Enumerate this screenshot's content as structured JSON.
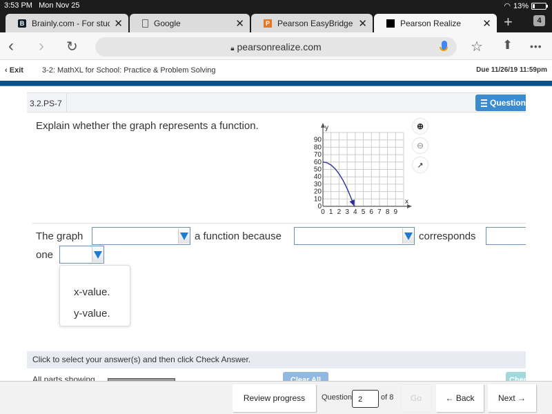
{
  "status_bar": {
    "time": "3:53 PM",
    "date": "Mon Nov 25",
    "battery": "13%"
  },
  "browser": {
    "tabs": [
      {
        "label": "Brainly.com - For students",
        "favicon": "B",
        "favicon_color": "#0e1e2e",
        "active": false
      },
      {
        "label": "Google",
        "favicon": "page-icon",
        "active": false
      },
      {
        "label": "Pearson EasyBridge",
        "favicon": "P",
        "favicon_color": "#e87722",
        "active": false
      },
      {
        "label": "Pearson Realize",
        "favicon": "realize-logo",
        "favicon_color": "#000000",
        "active": true
      }
    ],
    "tab_count": "4",
    "url": "pearsonrealize.com"
  },
  "app_header": {
    "exit_label": "Exit",
    "assignment_title": "3-2: MathXL for School: Practice & Problem Solving",
    "due": "Due 11/26/19 11:59pm"
  },
  "question": {
    "id": "3.2.PS-7",
    "question_button_label": "Question",
    "prompt": "Explain whether the graph represents a function.",
    "sentence": {
      "part1": "The graph",
      "part2": "a function because",
      "part3": "corresponds",
      "part4": "one"
    },
    "dropdowns": {
      "is_is_not": {
        "value": ""
      },
      "because": {
        "value": ""
      },
      "corresponds": {
        "value": ""
      },
      "one_value": {
        "value": "",
        "open": true,
        "options": [
          "x-value.",
          "y-value."
        ]
      }
    },
    "graph_tools": [
      "zoom-in-icon",
      "zoom-out-icon",
      "popout-icon"
    ]
  },
  "chart_data": {
    "type": "line",
    "title": "",
    "xlabel": "x",
    "ylabel": "y",
    "xlim": [
      0,
      9
    ],
    "ylim": [
      0,
      90
    ],
    "x_ticks": [
      "0",
      "1",
      "2",
      "3",
      "4",
      "5",
      "6",
      "7",
      "8",
      "9"
    ],
    "y_ticks": [
      "0",
      "10",
      "20",
      "30",
      "40",
      "50",
      "60",
      "70",
      "80",
      "90"
    ],
    "grid": true,
    "series": [
      {
        "name": "curve",
        "color": "#2b2f9e",
        "x": [
          0,
          0.5,
          1,
          1.5,
          2,
          2.5,
          3,
          3.5,
          3.9
        ],
        "y": [
          60,
          59,
          56,
          51,
          44,
          35,
          24,
          11,
          0
        ],
        "end_arrow": true
      }
    ]
  },
  "instructions": "Click to select your answer(s) and then click Check Answer.",
  "parts_label": "All parts showing",
  "clear_all_label": "Clear All",
  "check_label": "Check Answer",
  "bottom_nav": {
    "review_label": "Review progress",
    "question_label": "Question",
    "question_number": "2",
    "of_label": "of 8",
    "go_label": "Go",
    "back_label": "Back",
    "next_label": "Next"
  }
}
